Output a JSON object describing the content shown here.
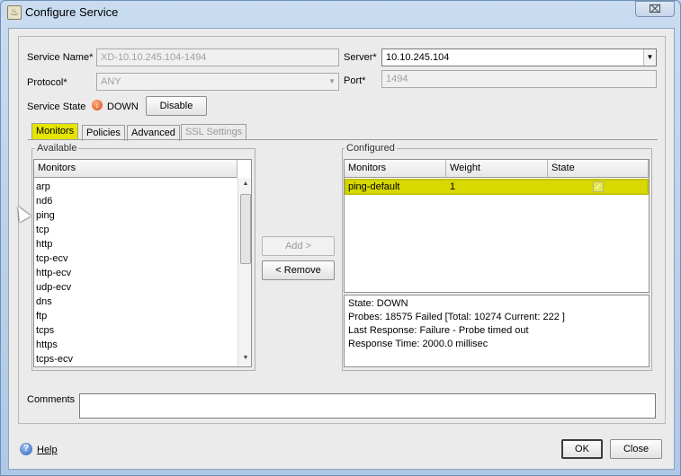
{
  "window": {
    "title": "Configure Service",
    "close_glyph": "⌧",
    "app_icon": "java-app-icon"
  },
  "form": {
    "service_name_label": "Service Name*",
    "service_name_value": "XD-10.10.245.104-1494",
    "server_label": "Server*",
    "server_value": "10.10.245.104",
    "protocol_label": "Protocol*",
    "protocol_value": "ANY",
    "port_label": "Port*",
    "port_value": "1494",
    "service_state_label": "Service State",
    "service_state_value": "DOWN",
    "disable_button": "Disable"
  },
  "tabs": [
    {
      "label": "Monitors",
      "active": true
    },
    {
      "label": "Policies",
      "active": false
    },
    {
      "label": "Advanced",
      "active": false
    },
    {
      "label": "SSL Settings",
      "active": false,
      "disabled": true
    }
  ],
  "available": {
    "group_title": "Available",
    "column": "Monitors",
    "items": [
      "arp",
      "nd6",
      "ping",
      "tcp",
      "http",
      "tcp-ecv",
      "http-ecv",
      "udp-ecv",
      "dns",
      "ftp",
      "tcps",
      "https",
      "tcps-ecv"
    ]
  },
  "actions": {
    "add_label": "Add >",
    "remove_label": "< Remove"
  },
  "configured": {
    "group_title": "Configured",
    "columns": [
      "Monitors",
      "Weight",
      "State"
    ],
    "rows": [
      {
        "monitor": "ping-default",
        "weight": "1",
        "state_checked": true
      }
    ],
    "details": {
      "state": "State: DOWN",
      "probes": "Probes: 18575    Failed [Total: 10274  Current: 222 ]",
      "last_response": "Last Response: Failure - Probe timed out",
      "response_time": "Response Time: 2000.0 millisec"
    }
  },
  "comments": {
    "label": "Comments",
    "value": ""
  },
  "footer": {
    "help_label": "Help",
    "ok_label": "OK",
    "close_label": "Close"
  },
  "colors": {
    "highlight": "#e5e500",
    "window_frame": "#aec8e6",
    "dialog_bg": "#ebebeb"
  }
}
